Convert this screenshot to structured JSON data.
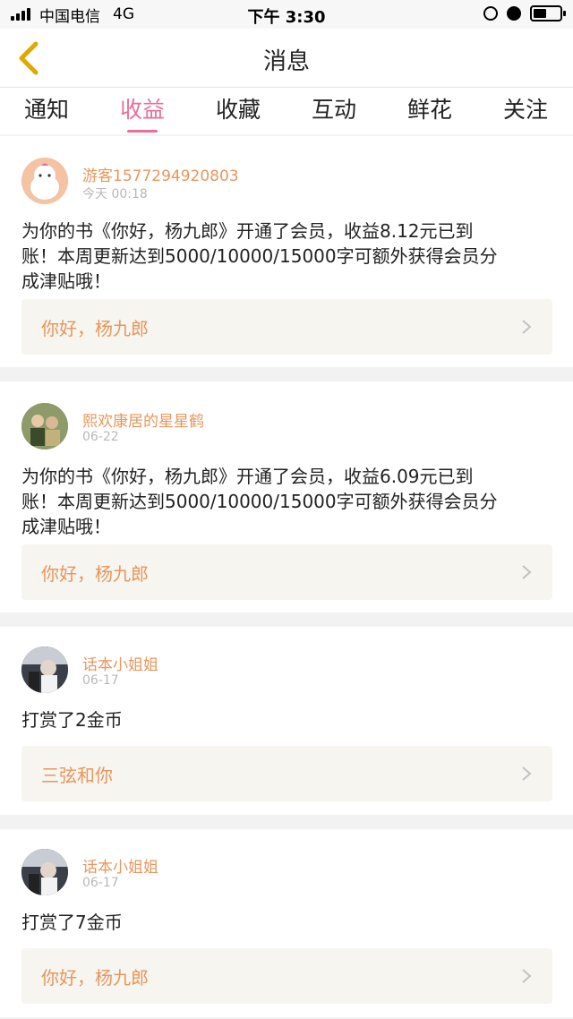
{
  "status_bar": {
    "carrier": "中国电信",
    "network": "4G",
    "time": "下午 3:30"
  },
  "header": {
    "title": "消息",
    "back_icon": "chevron-left-icon"
  },
  "tabs": [
    {
      "label": "通知",
      "active": false
    },
    {
      "label": "收益",
      "active": true
    },
    {
      "label": "收藏",
      "active": false
    },
    {
      "label": "互动",
      "active": false
    },
    {
      "label": "鲜花",
      "active": false
    },
    {
      "label": "关注",
      "active": false
    }
  ],
  "colors": {
    "accent": "#e86f9a",
    "username": "#e8965c",
    "link_bg": "#f6f5f0"
  },
  "messages": [
    {
      "user": "游客1577294920803",
      "time": "今天 00:18",
      "lines": [
        "为你的书《你好，杨九郎》开通了会员，收益8.12元已到",
        "账！本周更新达到5000/10000/15000字可额外获得会员分",
        "成津贴哦！"
      ],
      "book": "你好，杨九郎"
    },
    {
      "user": "熙欢康居的星星鹤",
      "time": "06-22",
      "lines": [
        "为你的书《你好，杨九郎》开通了会员，收益6.09元已到",
        "账！本周更新达到5000/10000/15000字可额外获得会员分",
        "成津贴哦！"
      ],
      "book": "你好，杨九郎"
    },
    {
      "user": "话本小姐姐",
      "time": "06-17",
      "lines": [
        "打赏了2金币"
      ],
      "book": "三弦和你"
    },
    {
      "user": "话本小姐姐",
      "time": "06-17",
      "lines": [
        "打赏了7金币"
      ],
      "book": "你好，杨九郎"
    }
  ]
}
